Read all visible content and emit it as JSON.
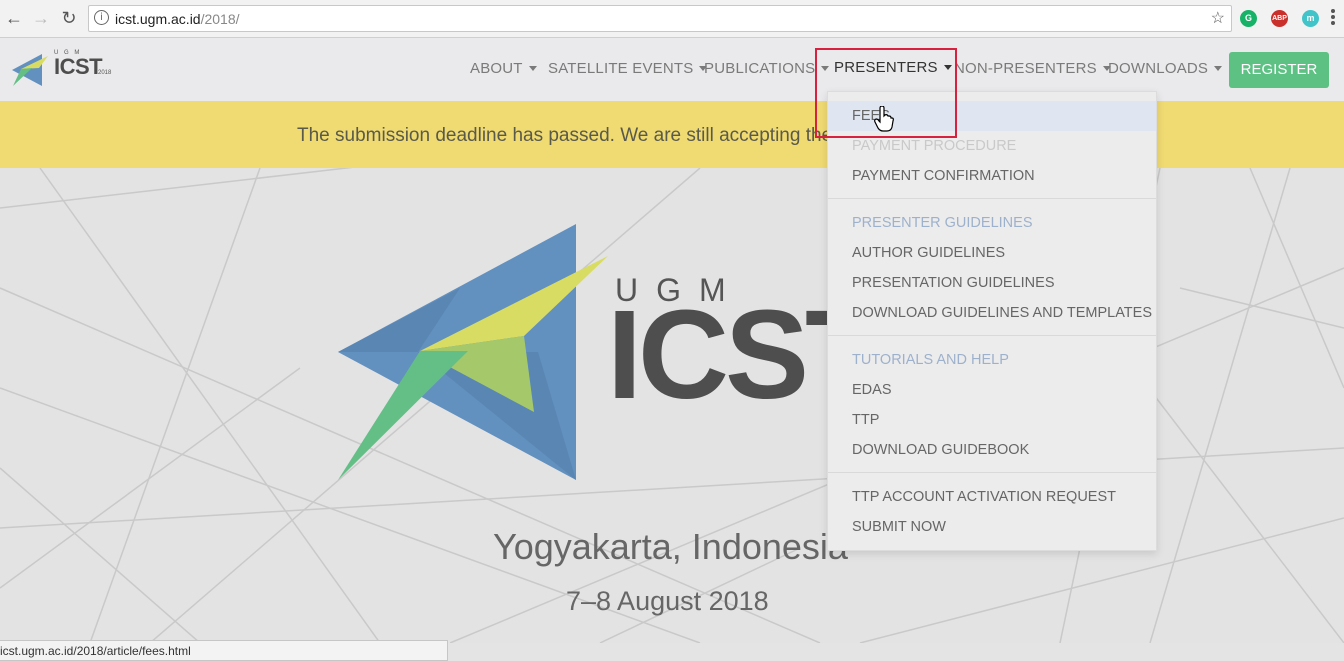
{
  "browser": {
    "url_host": "icst.ugm.ac.id",
    "url_path": "/2018/",
    "extensions": [
      "grammarly-icon",
      "adblock-plus-icon",
      "extension-m-icon"
    ],
    "abp_label": "ABP",
    "m_label": "m"
  },
  "header": {
    "logo": {
      "ugm": "U G M",
      "icst": "ICST",
      "year": "2018"
    },
    "nav": {
      "about": "ABOUT",
      "satellite": "SATELLITE EVENTS",
      "publications": "PUBLICATIONS",
      "presenters": "PRESENTERS",
      "non_presenters": "NON-PRESENTERS",
      "downloads": "DOWNLOADS"
    },
    "register": "REGISTER"
  },
  "banner": {
    "text": "The submission deadline has passed. We are still accepting the"
  },
  "hero": {
    "ugm": "UGM",
    "icst": "ICST",
    "location": "Yogyakarta, Indonesia",
    "date": "7–8 August 2018"
  },
  "dropdown": {
    "fees": "FEES",
    "payment_procedure": "PAYMENT PROCEDURE",
    "payment_confirmation": "PAYMENT CONFIRMATION",
    "presenter_guidelines": "PRESENTER GUIDELINES",
    "author_guidelines": "AUTHOR GUIDELINES",
    "presentation_guidelines": "PRESENTATION GUIDELINES",
    "download_templates": "DOWNLOAD GUIDELINES AND TEMPLATES",
    "tutorials": "TUTORIALS AND HELP",
    "edas": "EDAS",
    "ttp": "TTP",
    "guidebook": "DOWNLOAD GUIDEBOOK",
    "ttp_activation": "TTP ACCOUNT ACTIVATION REQUEST",
    "submit_now": "SUBMIT NOW"
  },
  "status_bar": {
    "text": "icst.ugm.ac.id/2018/article/fees.html"
  },
  "colors": {
    "banner": "#f0da72",
    "register": "#5cc183",
    "highlight_box": "#d8213f",
    "logo_blue": "#6290bf",
    "logo_yellow": "#d8dc62",
    "logo_green": "#63bf86"
  }
}
